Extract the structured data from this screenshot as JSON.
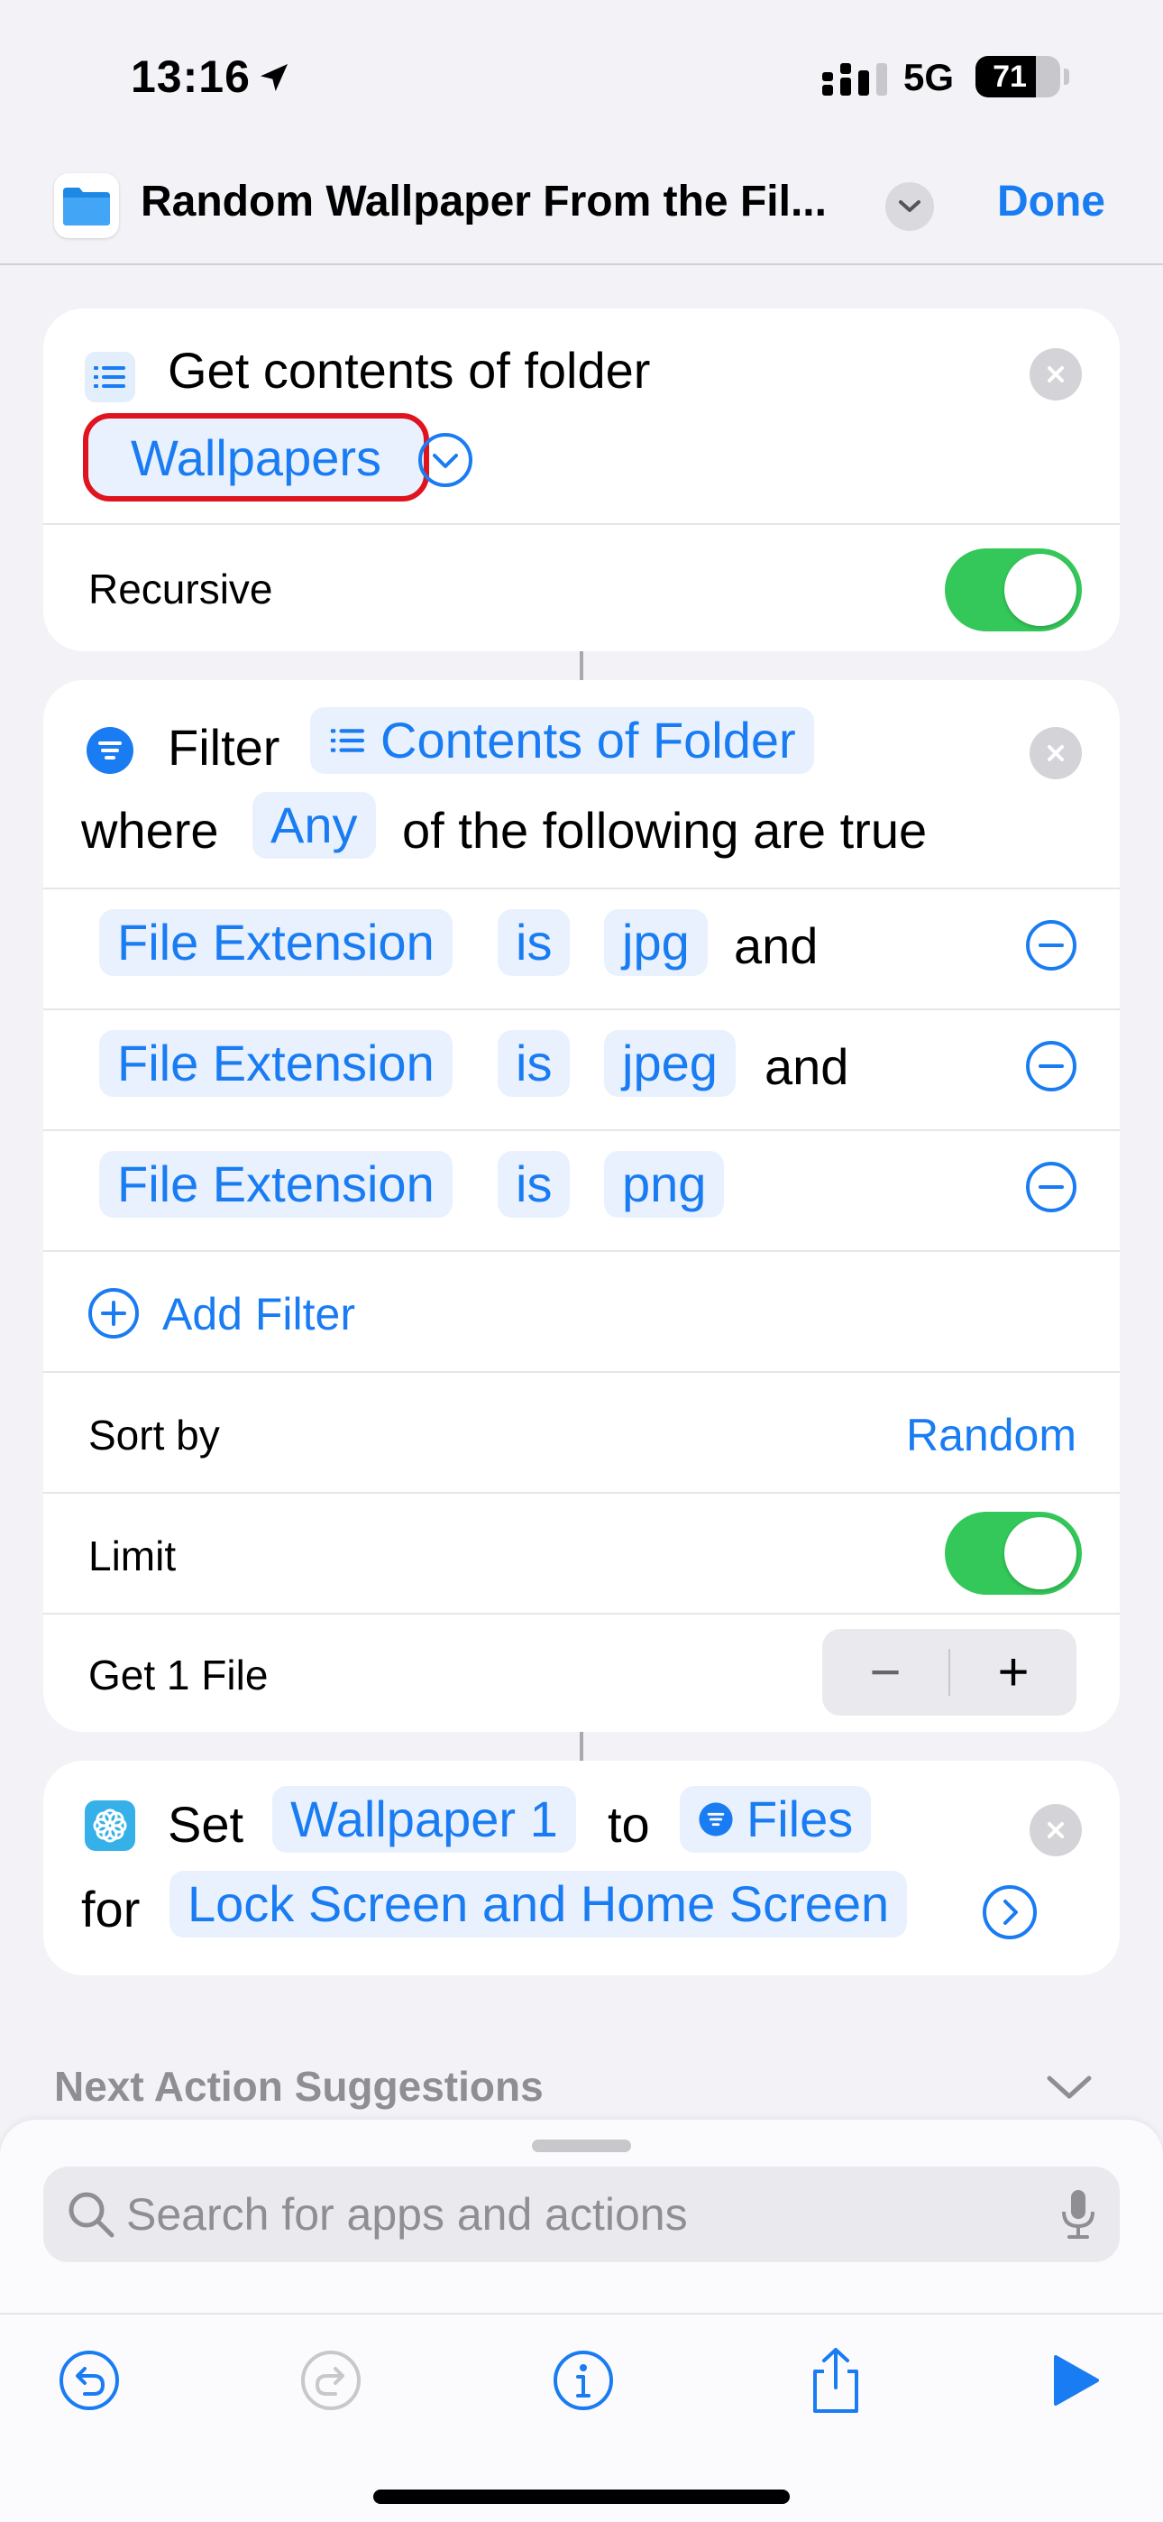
{
  "status": {
    "time": "13:16",
    "network": "5G",
    "battery": "71",
    "battery_level": 0.71
  },
  "nav": {
    "title": "Random Wallpaper From the Fil...",
    "done": "Done"
  },
  "folder_action": {
    "title": "Get contents of folder",
    "folder": "Wallpapers",
    "recursive_label": "Recursive",
    "recursive_on": true
  },
  "filter_action": {
    "title": "Filter",
    "input": "Contents of Folder",
    "where": "where",
    "mode": "Any",
    "following": "of the following are true",
    "conditions": [
      {
        "field": "File Extension",
        "op": "is",
        "value": "jpg",
        "join": "and"
      },
      {
        "field": "File Extension",
        "op": "is",
        "value": "jpeg",
        "join": "and"
      },
      {
        "field": "File Extension",
        "op": "is",
        "value": "png",
        "join": ""
      }
    ],
    "add_filter": "Add Filter",
    "sort_label": "Sort by",
    "sort_value": "Random",
    "limit_label": "Limit",
    "limit_on": true,
    "get_label": "Get 1 File",
    "stepper_minus": "−",
    "stepper_plus": "+"
  },
  "wallpaper_action": {
    "set": "Set",
    "wallpaper": "Wallpaper 1",
    "to": "to",
    "files": "Files",
    "for": "for",
    "target": "Lock Screen and Home Screen"
  },
  "suggestions": {
    "title": "Next Action Suggestions"
  },
  "search": {
    "placeholder": "Search for apps and actions"
  },
  "colors": {
    "accent": "#1a7cf2",
    "toggle_on": "#34c759",
    "highlight": "#e0141e"
  }
}
